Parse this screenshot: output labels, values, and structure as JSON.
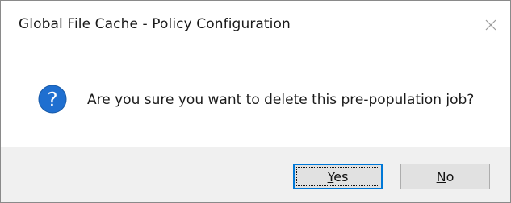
{
  "window": {
    "title": "Global File Cache - Policy Configuration",
    "close_icon": "close-icon"
  },
  "message": {
    "icon": "question-icon",
    "text": "Are you sure you want to delete this pre-population job?"
  },
  "buttons": {
    "yes": {
      "mnemonic": "Y",
      "rest": "es",
      "label": "Yes",
      "default": true
    },
    "no": {
      "mnemonic": "N",
      "rest": "o",
      "label": "No",
      "default": false
    }
  },
  "colors": {
    "accent": "#0078d7",
    "footer_bg": "#f0f0f0",
    "button_bg": "#e1e1e1"
  }
}
